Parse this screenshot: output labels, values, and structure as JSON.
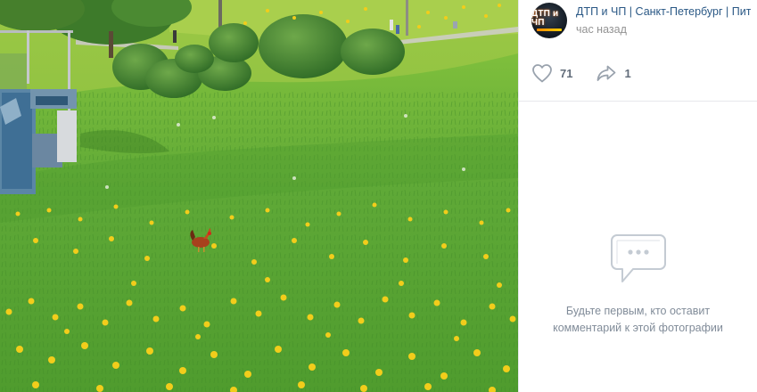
{
  "post": {
    "author": "ДТП и ЧП | Санкт-Петербург | Пит",
    "time": "час назад",
    "avatar_text": "ДТП и ЧП"
  },
  "actions": {
    "likes": "71",
    "shares": "1"
  },
  "comments": {
    "empty_line1": "Будьте первым, кто оставит",
    "empty_line2": "комментарий к этой фотографии"
  },
  "colors": {
    "link": "#2a5885",
    "muted": "#939393",
    "icon": "#99a2ad",
    "grass": "#5aa532",
    "dandelion": "#f2cd1b"
  },
  "photo": {
    "icons": [
      "rooster",
      "dandelions",
      "bushes",
      "trees",
      "fence"
    ]
  }
}
